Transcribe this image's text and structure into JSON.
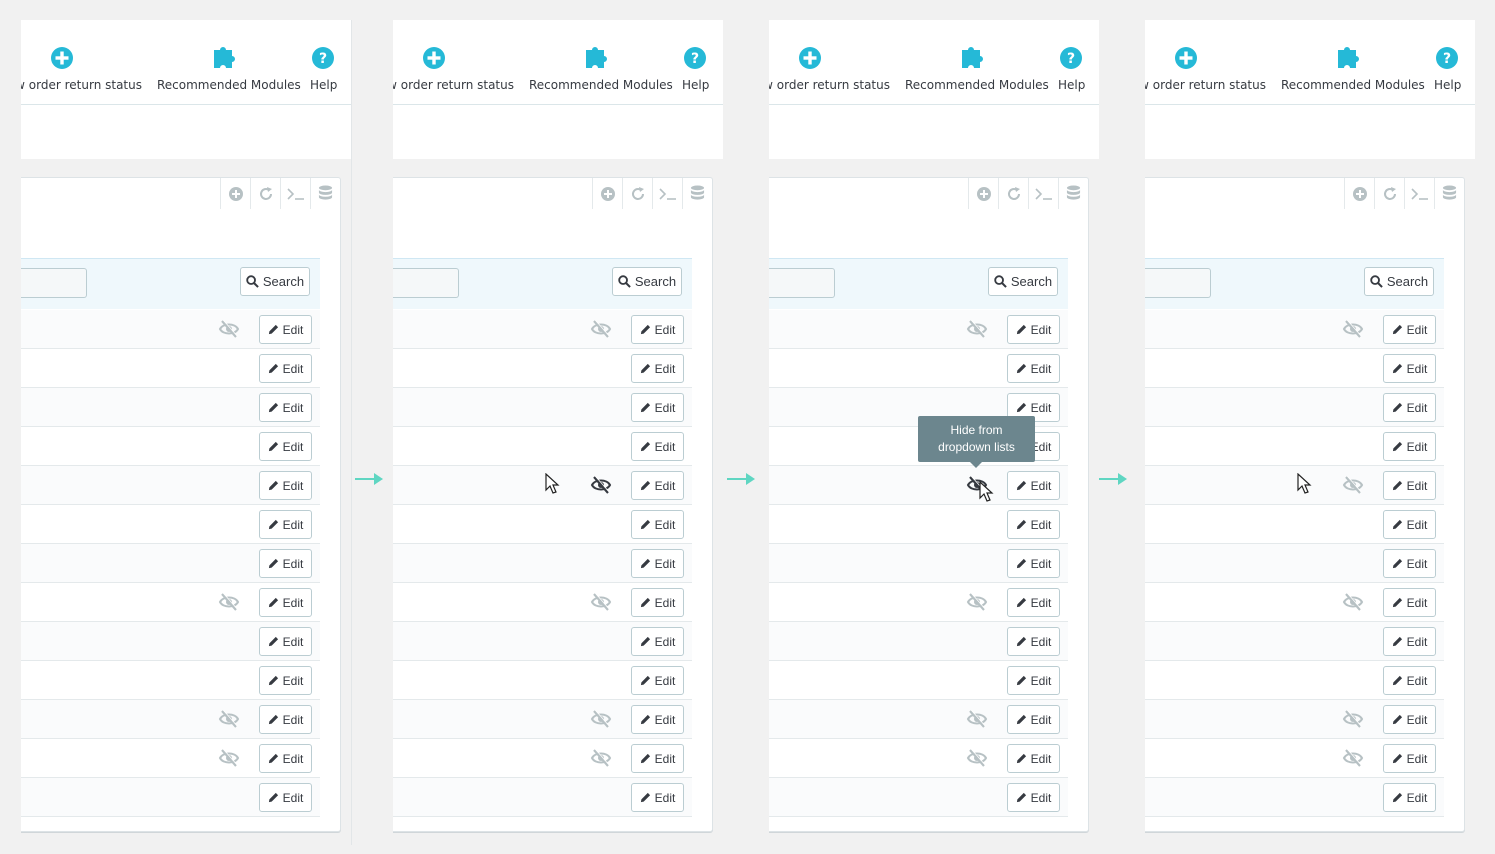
{
  "toolbar": {
    "add_label": "w order return status",
    "modules_label": "Recommended Modules",
    "help_label": "Help"
  },
  "filter": {
    "search_label": "Search"
  },
  "rows": {
    "edit_label": "Edit",
    "count": 13
  },
  "tooltip": {
    "line1": "Hide from",
    "line2": "dropdown lists"
  },
  "colors": {
    "accent": "#25b9d7",
    "arrow": "#5fd6c2",
    "tooltip_bg": "#6c868e",
    "eye_muted": "#b7c1c4",
    "eye_dark": "#363a41"
  }
}
